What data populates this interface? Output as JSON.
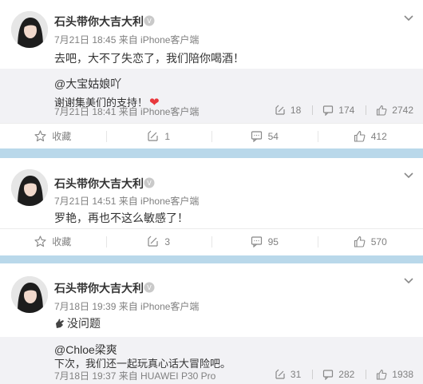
{
  "posts": [
    {
      "username": "石头带你大吉大利",
      "meta": "7月21日 18:45 来自 iPhone客户端",
      "text": "去吧，大不了失恋了，我们陪你喝酒！",
      "quote": {
        "user": "@大宝姑娘吖",
        "text": "谢谢集美们的支持！",
        "meta": "7月21日 18:41 来自 iPhone客户端",
        "reposts": "18",
        "comments": "174",
        "likes": "2742"
      },
      "actions": {
        "favorite": "收藏",
        "repost": "1",
        "comment": "54",
        "like": "412"
      }
    },
    {
      "username": "石头带你大吉大利",
      "meta": "7月21日 14:51 来自 iPhone客户端",
      "text": "罗艳，再也不这么敏感了！",
      "actions": {
        "favorite": "收藏",
        "repost": "3",
        "comment": "95",
        "like": "570"
      }
    },
    {
      "username": "石头带你大吉大利",
      "meta": "7月18日 19:39 来自 iPhone客户端",
      "text": "没问题",
      "quote": {
        "user": "@Chloe梁爽",
        "text": "下次，我们还一起玩真心话大冒险吧。",
        "meta": "7月18日 19:37 来自 HUAWEI P30 Pro",
        "reposts": "31",
        "comments": "282",
        "likes": "1938"
      }
    }
  ],
  "icons": {
    "vip": "vip-badge-icon",
    "chevron": "chevron-down-icon",
    "favorite": "star-icon",
    "repost": "repost-icon",
    "comment": "comment-icon",
    "like": "thumbs-up-icon",
    "heart": "red-heart-emoji",
    "ok_hand": "ok-hand-emoji"
  },
  "colors": {
    "separator": "#b9d8ea",
    "quote_bg": "#f2f2f5",
    "meta": "#808080",
    "heart": "#e8383d"
  }
}
